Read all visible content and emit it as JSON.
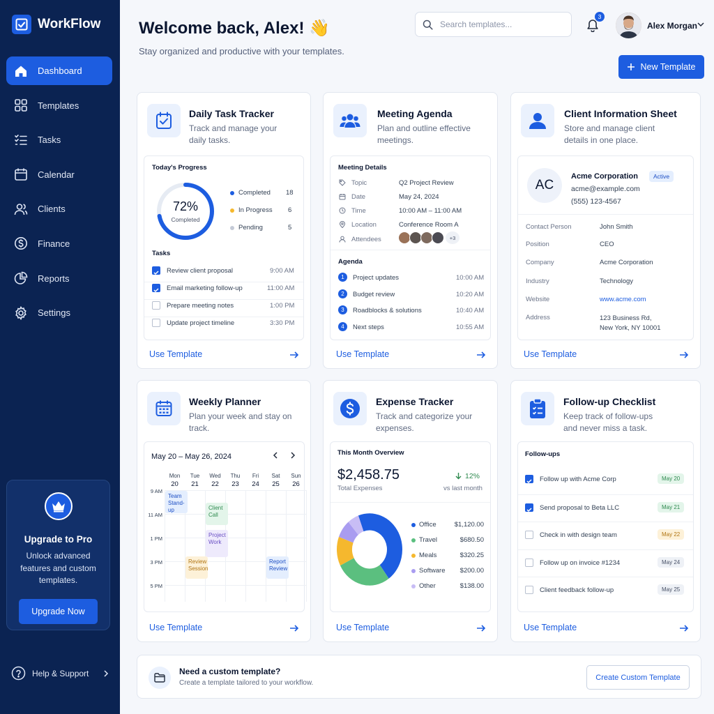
{
  "app": {
    "name": "WorkFlow"
  },
  "nav": [
    {
      "label": "Dashboard",
      "icon": "home-icon",
      "active": true
    },
    {
      "label": "Templates",
      "icon": "grid-icon"
    },
    {
      "label": "Tasks",
      "icon": "list-check-icon"
    },
    {
      "label": "Calendar",
      "icon": "calendar-icon"
    },
    {
      "label": "Clients",
      "icon": "users-icon"
    },
    {
      "label": "Finance",
      "icon": "dollar-icon"
    },
    {
      "label": "Reports",
      "icon": "pie-chart-icon"
    },
    {
      "label": "Settings",
      "icon": "gear-icon"
    }
  ],
  "upgrade": {
    "title": "Upgrade to Pro",
    "text": "Unlock advanced features and custom templates.",
    "button": "Upgrade Now"
  },
  "help": {
    "label": "Help & Support"
  },
  "header": {
    "welcome": "Welcome back, Alex! 👋",
    "subtitle": "Stay organized and productive with your templates.",
    "search_placeholder": "Search templates...",
    "notifications": "3",
    "user_name": "Alex Morgan",
    "new_template": "New Template"
  },
  "use_template": "Use Template",
  "cards": {
    "daily": {
      "title": "Daily Task Tracker",
      "desc": "Track and manage your daily tasks.",
      "progress_title": "Today's Progress",
      "percent": "72%",
      "percent_value": 72,
      "percent_label": "Completed",
      "stats": [
        {
          "label": "Completed",
          "value": "18",
          "color": "#1d5de0"
        },
        {
          "label": "In Progress",
          "value": "6",
          "color": "#f5b82e"
        },
        {
          "label": "Pending",
          "value": "5",
          "color": "#c4cad6"
        }
      ],
      "tasks_title": "Tasks",
      "tasks": [
        {
          "label": "Review client proposal",
          "time": "9:00 AM",
          "done": true
        },
        {
          "label": "Email marketing follow-up",
          "time": "11:00 AM",
          "done": true
        },
        {
          "label": "Prepare meeting notes",
          "time": "1:00 PM",
          "done": false
        },
        {
          "label": "Update project timeline",
          "time": "3:30 PM",
          "done": false
        }
      ]
    },
    "meeting": {
      "title": "Meeting Agenda",
      "desc": "Plan and outline effective meetings.",
      "details_title": "Meeting Details",
      "details": [
        {
          "label": "Topic",
          "value": "Q2 Project Review",
          "icon": "tag-icon"
        },
        {
          "label": "Date",
          "value": "May 24, 2024",
          "icon": "calendar-icon"
        },
        {
          "label": "Time",
          "value": "10:00 AM – 11:00 AM",
          "icon": "clock-icon"
        },
        {
          "label": "Location",
          "value": "Conference Room A",
          "icon": "location-pin-icon"
        },
        {
          "label": "Attendees",
          "value": "",
          "icon": "user-icon"
        }
      ],
      "attendees_more": "+3",
      "agenda_title": "Agenda",
      "agenda": [
        {
          "n": "1",
          "label": "Project updates",
          "time": "10:00 AM"
        },
        {
          "n": "2",
          "label": "Budget review",
          "time": "10:20 AM"
        },
        {
          "n": "3",
          "label": "Roadblocks & solutions",
          "time": "10:40 AM"
        },
        {
          "n": "4",
          "label": "Next steps",
          "time": "10:55 AM"
        }
      ]
    },
    "client": {
      "title": "Client Information Sheet",
      "desc": "Store and manage client details in one place.",
      "initials": "AC",
      "company": "Acme Corporation",
      "status": "Active",
      "email": "acme@example.com",
      "phone": "(555) 123-4567",
      "fields": [
        {
          "label": "Contact Person",
          "value": "John Smith"
        },
        {
          "label": "Position",
          "value": "CEO"
        },
        {
          "label": "Company",
          "value": "Acme Corporation"
        },
        {
          "label": "Industry",
          "value": "Technology"
        },
        {
          "label": "Website",
          "value": "www.acme.com",
          "link": true
        },
        {
          "label": "Address",
          "value": "123 Business Rd,\nNew York, NY 10001"
        }
      ]
    },
    "weekly": {
      "title": "Weekly Planner",
      "desc": "Plan your week and stay on track.",
      "range": "May 20 – May 26, 2024",
      "days": [
        {
          "d": "Mon",
          "n": "20"
        },
        {
          "d": "Tue",
          "n": "21"
        },
        {
          "d": "Wed",
          "n": "22"
        },
        {
          "d": "Thu",
          "n": "23"
        },
        {
          "d": "Fri",
          "n": "24"
        },
        {
          "d": "Sat",
          "n": "25"
        },
        {
          "d": "Sun",
          "n": "26"
        }
      ],
      "times": [
        "9 AM",
        "11 AM",
        "1 PM",
        "3 PM",
        "5 PM"
      ],
      "events": [
        {
          "label": "Team Stand-up",
          "day": 0,
          "start": 0,
          "span": 1,
          "bg": "#e4eefe",
          "fg": "#1d4fc4"
        },
        {
          "label": "Client Call",
          "day": 2,
          "start": 0.5,
          "span": 1,
          "bg": "#e3f5ea",
          "fg": "#2f8a4f"
        },
        {
          "label": "Project Work",
          "day": 2,
          "start": 1.65,
          "span": 1.2,
          "bg": "#eeeafc",
          "fg": "#6a4fc4"
        },
        {
          "label": "Review Session",
          "day": 1,
          "start": 2.75,
          "span": 1,
          "bg": "#fdf1d8",
          "fg": "#b07412"
        },
        {
          "label": "Report Review",
          "day": 5,
          "start": 2.75,
          "span": 1,
          "bg": "#e4eefe",
          "fg": "#1d4fc4"
        }
      ]
    },
    "expense": {
      "title": "Expense Tracker",
      "desc": "Track and categorize your expenses.",
      "overview_title": "This Month Overview",
      "total": "$2,458.75",
      "total_label": "Total Expenses",
      "change": "12%",
      "change_label": "vs last month",
      "categories": [
        {
          "label": "Office",
          "value": "$1,120.00",
          "amount": 1120,
          "color": "#1d5de0"
        },
        {
          "label": "Travel",
          "value": "$680.50",
          "amount": 680.5,
          "color": "#5bbf7f"
        },
        {
          "label": "Meals",
          "value": "$320.25",
          "amount": 320.25,
          "color": "#f5b82e"
        },
        {
          "label": "Software",
          "value": "$200.00",
          "amount": 200,
          "color": "#a99cf0"
        },
        {
          "label": "Other",
          "value": "$138.00",
          "amount": 138,
          "color": "#c8bdf5"
        }
      ]
    },
    "followup": {
      "title": "Follow-up Checklist",
      "desc": "Keep track of follow-ups and never miss a task.",
      "list_title": "Follow-ups",
      "items": [
        {
          "label": "Follow up with Acme Corp",
          "date": "May 20",
          "done": true,
          "bg": "#e3f5ea",
          "fg": "#2f8a4f"
        },
        {
          "label": "Send proposal to Beta LLC",
          "date": "May 21",
          "done": true,
          "bg": "#e3f5ea",
          "fg": "#2f8a4f"
        },
        {
          "label": "Check in with design team",
          "date": "May 22",
          "done": false,
          "bg": "#fdf1d8",
          "fg": "#b07412"
        },
        {
          "label": "Follow up on invoice #1234",
          "date": "May 24",
          "done": false,
          "bg": "#eef1f6",
          "fg": "#475066"
        },
        {
          "label": "Client feedback follow-up",
          "date": "May 25",
          "done": false,
          "bg": "#eef1f6",
          "fg": "#475066"
        }
      ]
    }
  },
  "custom": {
    "title": "Need a custom template?",
    "text": "Create a template tailored to your workflow.",
    "button": "Create Custom Template"
  }
}
